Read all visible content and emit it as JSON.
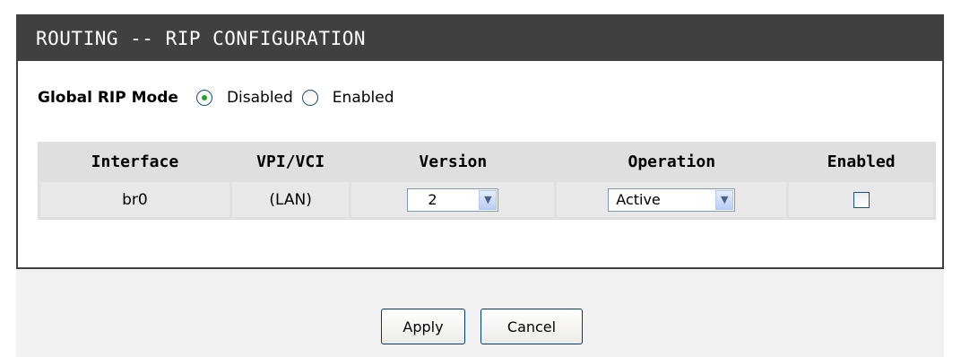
{
  "panel": {
    "title": "ROUTING -- RIP CONFIGURATION"
  },
  "global_mode": {
    "label": "Global RIP Mode",
    "options": [
      {
        "label": "Disabled",
        "checked": true
      },
      {
        "label": "Enabled",
        "checked": false
      }
    ]
  },
  "table": {
    "headers": [
      "Interface",
      "VPI/VCI",
      "Version",
      "Operation",
      "Enabled"
    ],
    "rows": [
      {
        "interface": "br0",
        "vpi_vci": "(LAN)",
        "version": "2",
        "operation": "Active",
        "enabled": false
      }
    ]
  },
  "buttons": {
    "apply": "Apply",
    "cancel": "Cancel"
  },
  "icons": {
    "dropdown": "chevron-down-icon"
  }
}
